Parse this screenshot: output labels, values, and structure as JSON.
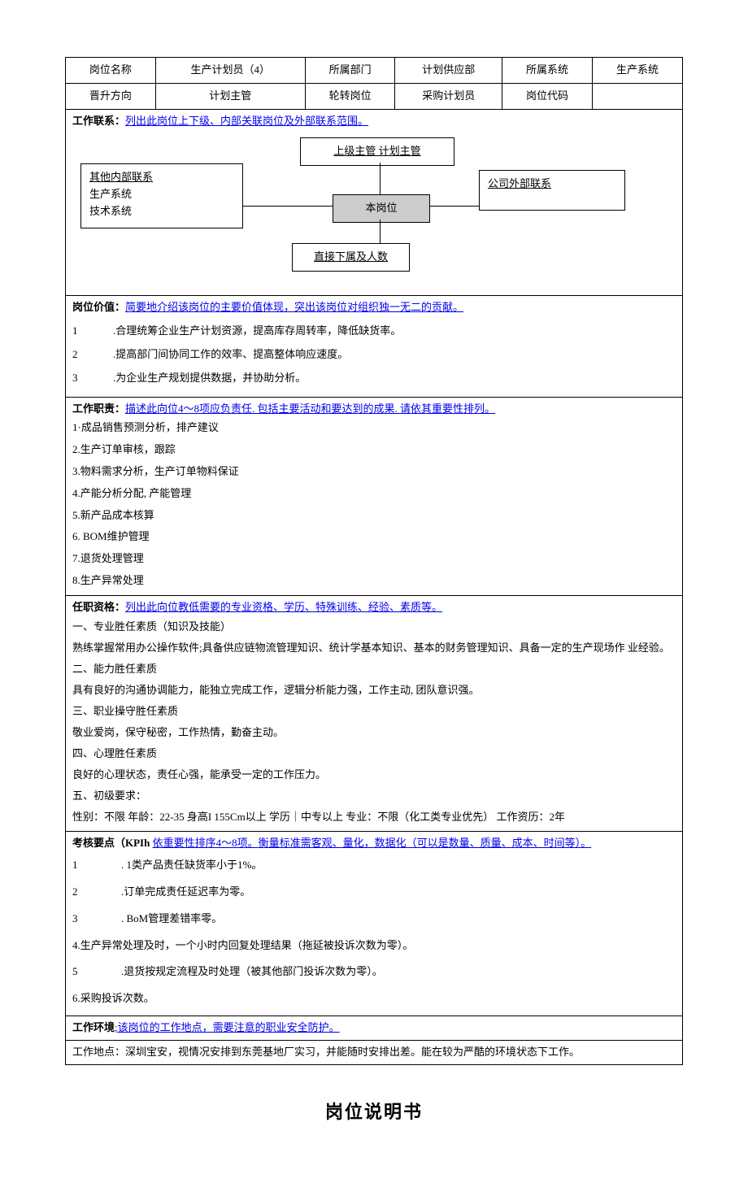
{
  "header": {
    "r1": {
      "c1": "岗位名称",
      "c2": "生产计划员（4）",
      "c3": "所属部门",
      "c4": "计划供应部",
      "c5": "所属系统",
      "c6": "生产系统"
    },
    "r2": {
      "c1": "晋升方向",
      "c2": "计划主管",
      "c3": "轮转岗位",
      "c4": "采购计划员",
      "c5": "岗位代码",
      "c6": ""
    }
  },
  "contact": {
    "label": "工作联系：",
    "hint": "列出此岗位上下级、内部关联岗位及外部联系范围。",
    "diagram": {
      "top": "上级主管    计划主管",
      "center": "本岗位",
      "leftTitle": "其他内部联系",
      "leftLine1": "生产系统",
      "leftLine2": "技术系统",
      "right": "公司外部联系",
      "bottom": "直接下属及人数"
    }
  },
  "value": {
    "label": "岗位价值：",
    "hint": "简要地介绍该岗位的主要价值体现，突出该岗位对组织独一无二的贡献。",
    "items": {
      "n1": "1",
      "t1": ".合理统筹企业生产计划资源，提高库存周转率，降低缺货率。",
      "n2": "2",
      "t2": ".提高部门间协同工作的效率、提高整体响应速度。",
      "n3": "3",
      "t3": ".为企业生产规划提供数据，并协助分析。"
    }
  },
  "duties": {
    "label": "工作职责：",
    "hint": "描述此向位4～8项应负责任. 包括主要活动和要达到的成果. 请依其重要性排列。",
    "items": {
      "i1": "1·成品销售预测分析，排产建议",
      "i2": "2.生产订单审核，跟踪",
      "i3": "3.物料需求分析，生产订单物料保证",
      "i4": "4.产能分析分配, 产能管理",
      "i5": "5.新产品成本核算",
      "i6": "6. BOM维护管理",
      "i7": "7.退货处理管理",
      "i8": "8.生产异常处理"
    }
  },
  "qualifications": {
    "label": "任职资格：",
    "hint": "列出此向位教低需要的专业资格、学历、特殊训练、经验、素质等。",
    "h1": "一、专业胜任素质（知识及技能）",
    "p1": "熟练掌握常用办公操作软件;具备供应链物流管理知识、统计学基本知识、基本的财务管理知识、具备一定的生产现场作 业经验。",
    "h2": "二、能力胜任素质",
    "p2": "具有良好的沟通协调能力，能独立完成工作，逻辑分析能力强，工作主动, 团队意识强。",
    "h3": "三、职业操守胜任素质",
    "p3": "敬业爱岗，保守秘密，工作热情，勤奋主动。",
    "h4": "四、心理胜任素质",
    "p4": "良好的心理状态，责任心强，能承受一定的工作压力。",
    "h5": "五、初级要求：",
    "p5": "性别：不限 年龄：22-35 身高I 155Cm以上 学历｜中专以上 专业：不限（化工类专业优先） 工作资历：2年"
  },
  "kpi": {
    "label": "考核要点（KPIh ",
    "hint": "依重要性排序4～8项。衡量标准需客观、量化，数据化（可以是数量、质量、成本、时间等）。",
    "items": {
      "n1": "1",
      "t1": ". 1类产品责任缺货率小于1%。",
      "n2": "2",
      "t2": ".订单完成责任延迟率为零。",
      "n3": "3",
      "t3": ". BoM管理差错率零。",
      "t4": "4.生产异常处理及时，一个小时内回复处理结果（拖延被投诉次数为零）。",
      "n5": "5",
      "t5": ".退货按规定流程及时处理（被其他部门投诉次数为零）。",
      "t6": "6.采购投诉次数。"
    }
  },
  "environment": {
    "label": "工作环境",
    "hint": ";该岗位的工作地点，需要注意的职业安全防护。",
    "text": "工作地点：深圳宝安，视情况安排到东莞基地厂实习，并能随时安排出差。能在较为严酷的环境状态下工作。"
  },
  "pageTitle": "岗位说明书"
}
